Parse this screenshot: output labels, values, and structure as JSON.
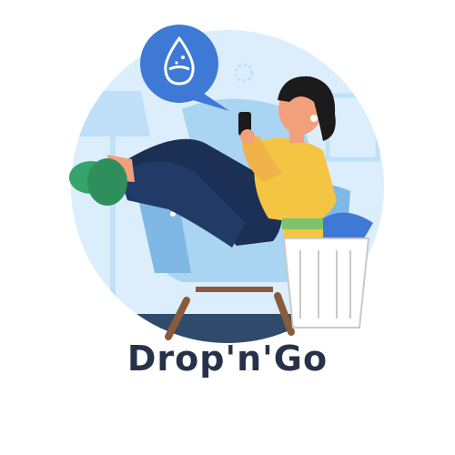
{
  "brand": {
    "name": "Drop'n'Go"
  },
  "colors": {
    "background": "#ffffff",
    "circle": "#dceefc",
    "accent_blue": "#3f79d6",
    "chair": "#a9d4f2",
    "chair_dark": "#7fb8e4",
    "pants": "#1c2f55",
    "sweater": "#f3c542",
    "skin": "#f2a07b",
    "hair": "#1b1b1b",
    "slippers": "#35a36b",
    "brand_text": "#27324a"
  },
  "icons": {
    "bubble": "water-drop-icon"
  }
}
